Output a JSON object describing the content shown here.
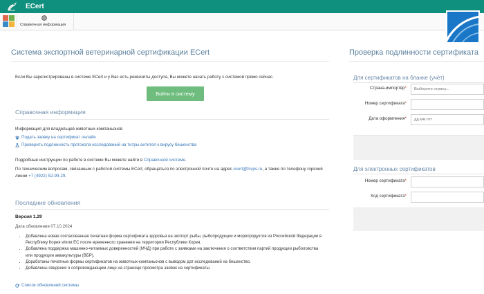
{
  "app": {
    "title": "ECert"
  },
  "toolbar": {
    "help_label": "Справочная информация"
  },
  "main": {
    "title": "Система экспортной ветеринарной сертификации ECert",
    "intro": "Если Вы зарегистрированы в системе ECert и у Вас есть реквизиты доступа, Вы можете начать работу с системой прямо сейчас.",
    "login_label": "Войти в систему"
  },
  "reference": {
    "title": "Справочная информация",
    "pet_owners": "Информация для владельцев животных-компаньонов",
    "link_application": "Подать заявку на сертификат онлайн",
    "link_protocol": "Проверить подлинность протокола исследований на титры антител к вирусу бешенства",
    "instructions_prefix": "Подробные инструкции по работе в системе Вы можете найти в ",
    "instructions_link": "Справочной системе",
    "instructions_suffix": ".",
    "contact_prefix": "По техническим вопросам, связанным с работой системы ECert, обращаться по электронной почте на адрес ",
    "contact_email": "ecert@fsvps.ru",
    "contact_middle": ", а также по телефону горячей линии ",
    "contact_phone": "+7 (4922) 52-99-29",
    "contact_suffix": "."
  },
  "updates": {
    "title": "Последние обновления",
    "version": "Версия 1.29",
    "date": "Дата обновления 07.10.2024",
    "items": [
      "Добавлена новая согласованная печатная форма сертификата здоровья на экспорт рыбы, рыбопродукции и морепродуктов из Российской Федерации в Республику Корея и/или ЕС после временного хранения на территории Республики Корея.",
      "Добавлена поддержка машинно-читаемых доверенностей (МЧД) при работе с заявками на заключения о соответствии партий продукции рыболовства или продукции аквакультуры (ВБР).",
      "Доработаны печатные формы сертификатов на животных-компаньонов с выводом дат исследований на бешенство.",
      "Добавлены сведения о сопровождающем лице на странице просмотра заявок на сертификаты."
    ],
    "list_link": "Список обновлений системы"
  },
  "verify": {
    "title": "Проверка подлинности сертификата",
    "paper": {
      "title": "Для сертификатов на бланке (учёт)",
      "country_label": "Страна-импортёр",
      "country_placeholder": "Выберите страну...",
      "number_label": "Номер сертификата",
      "date_label": "Дата оформления",
      "date_placeholder": "дд.мм.гггг"
    },
    "electronic": {
      "title": "Для электронных сертификатов",
      "number_label": "Номер сертификата",
      "code_label": "Код сертификата"
    },
    "required_mark": "*"
  },
  "colors": {
    "header": "#0f8f7e",
    "accent_button": "#6ebd7e",
    "link": "#3777b8",
    "heading": "#5a7f9c",
    "badge": "#1a76c6"
  }
}
